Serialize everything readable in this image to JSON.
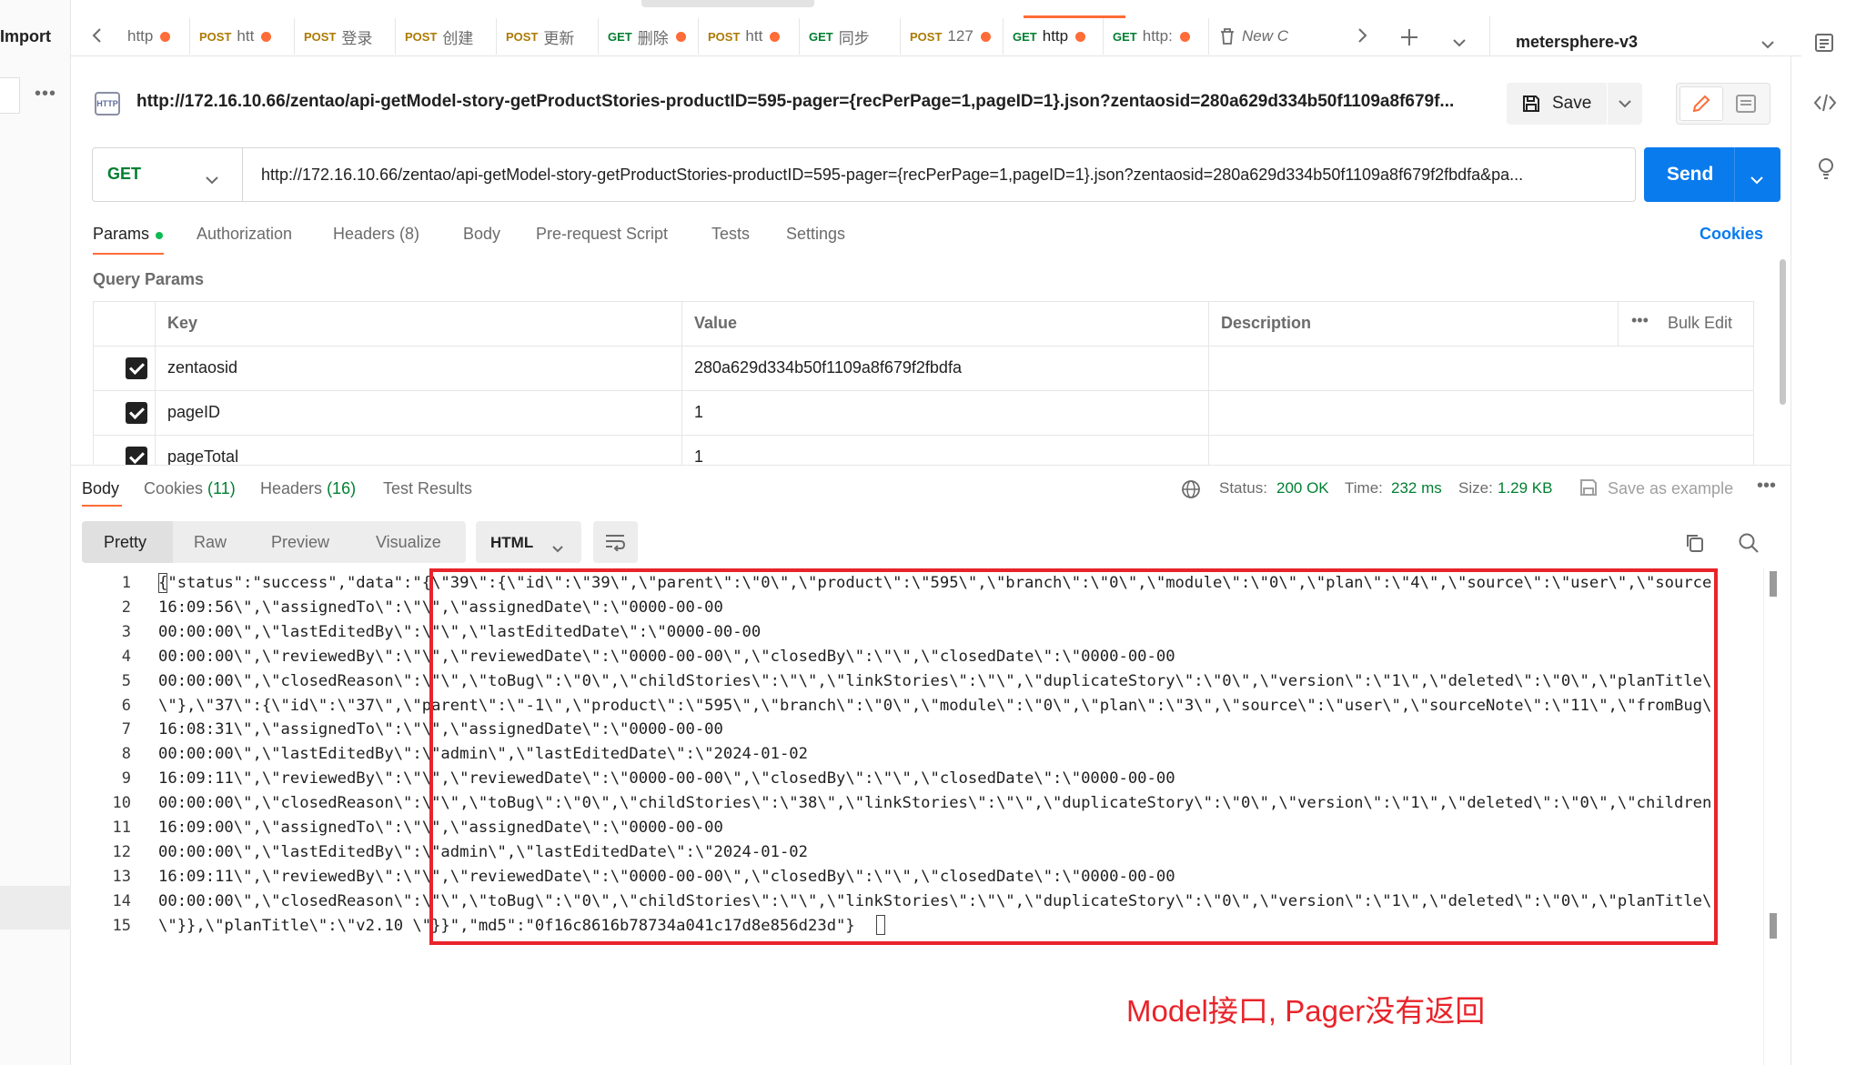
{
  "sidebar": {
    "import_label": "Import",
    "more_glyph": "•••"
  },
  "tabs": [
    {
      "method": "",
      "title": "http",
      "dot": true
    },
    {
      "method": "POST",
      "title": "htt",
      "dot": true
    },
    {
      "method": "POST",
      "title": "登录",
      "dot": false
    },
    {
      "method": "POST",
      "title": "创建",
      "dot": false
    },
    {
      "method": "POST",
      "title": "更新",
      "dot": false
    },
    {
      "method": "GET",
      "title": "删除",
      "dot": true
    },
    {
      "method": "POST",
      "title": "htt",
      "dot": true
    },
    {
      "method": "GET",
      "title": "同步",
      "dot": false
    },
    {
      "method": "POST",
      "title": "127",
      "dot": true
    },
    {
      "method": "GET",
      "title": "http",
      "dot": true
    },
    {
      "method": "GET",
      "title": "http:",
      "dot": true
    },
    {
      "method": "",
      "title": "New C",
      "dot": false
    }
  ],
  "workspace": {
    "name": "metersphere-v3"
  },
  "request": {
    "title": "http://172.16.10.66/zentao/api-getModel-story-getProductStories-productID=595-pager={recPerPage=1,pageID=1}.json?zentaosid=280a629d334b50f1109a8f679f...",
    "method": "GET",
    "url": "http://172.16.10.66/zentao/api-getModel-story-getProductStories-productID=595-pager={recPerPage=1,pageID=1}.json?zentaosid=280a629d334b50f1109a8f679f2fbdfa&pa...",
    "save_label": "Save",
    "send_label": "Send"
  },
  "req_tabs": {
    "params": "Params",
    "authorization": "Authorization",
    "headers": "Headers (8)",
    "body": "Body",
    "prerequest": "Pre-request Script",
    "tests": "Tests",
    "settings": "Settings",
    "cookies": "Cookies"
  },
  "query_params": {
    "title": "Query Params",
    "headers": {
      "key": "Key",
      "value": "Value",
      "description": "Description",
      "bulk_edit": "Bulk Edit"
    },
    "rows": [
      {
        "key": "zentaosid",
        "value": "280a629d334b50f1109a8f679f2fbdfa",
        "checked": true
      },
      {
        "key": "pageID",
        "value": "1",
        "checked": true
      },
      {
        "key": "pageTotal",
        "value": "1",
        "checked": true
      }
    ]
  },
  "response": {
    "tabs": {
      "body": "Body",
      "cookies": "Cookies",
      "cookies_count": "(11)",
      "headers": "Headers",
      "headers_count": "(16)",
      "test_results": "Test Results"
    },
    "status_label": "Status:",
    "status_value": "200 OK",
    "time_label": "Time:",
    "time_value": "232 ms",
    "size_label": "Size:",
    "size_value": "1.29 KB",
    "save_example": "Save as example",
    "views": {
      "pretty": "Pretty",
      "raw": "Raw",
      "preview": "Preview",
      "visualize": "Visualize"
    },
    "lang": "HTML",
    "lines": [
      "{\"status\":\"success\",\"data\":\"{\\\"39\\\":{\\\"id\\\":\\\"39\\\",\\\"parent\\\":\\\"0\\\",\\\"product\\\":\\\"595\\\",\\\"branch\\\":\\\"0\\\",\\\"module\\\":\\\"0\\\",\\\"plan\\\":\\\"4\\\",\\\"source\\\":\\\"user\\\",\\\"source",
      "16:09:56\\\",\\\"assignedTo\\\":\\\"\\\",\\\"assignedDate\\\":\\\"0000-00-00",
      "00:00:00\\\",\\\"lastEditedBy\\\":\\\"\\\",\\\"lastEditedDate\\\":\\\"0000-00-00",
      "00:00:00\\\",\\\"reviewedBy\\\":\\\"\\\",\\\"reviewedDate\\\":\\\"0000-00-00\\\",\\\"closedBy\\\":\\\"\\\",\\\"closedDate\\\":\\\"0000-00-00",
      "00:00:00\\\",\\\"closedReason\\\":\\\"\\\",\\\"toBug\\\":\\\"0\\\",\\\"childStories\\\":\\\"\\\",\\\"linkStories\\\":\\\"\\\",\\\"duplicateStory\\\":\\\"0\\\",\\\"version\\\":\\\"1\\\",\\\"deleted\\\":\\\"0\\\",\\\"planTitle\\",
      "\\\"},\\\"37\\\":{\\\"id\\\":\\\"37\\\",\\\"parent\\\":\\\"-1\\\",\\\"product\\\":\\\"595\\\",\\\"branch\\\":\\\"0\\\",\\\"module\\\":\\\"0\\\",\\\"plan\\\":\\\"3\\\",\\\"source\\\":\\\"user\\\",\\\"sourceNote\\\":\\\"11\\\",\\\"fromBug\\",
      "16:08:31\\\",\\\"assignedTo\\\":\\\"\\\",\\\"assignedDate\\\":\\\"0000-00-00",
      "00:00:00\\\",\\\"lastEditedBy\\\":\\\"admin\\\",\\\"lastEditedDate\\\":\\\"2024-01-02",
      "16:09:11\\\",\\\"reviewedBy\\\":\\\"\\\",\\\"reviewedDate\\\":\\\"0000-00-00\\\",\\\"closedBy\\\":\\\"\\\",\\\"closedDate\\\":\\\"0000-00-00",
      "00:00:00\\\",\\\"closedReason\\\":\\\"\\\",\\\"toBug\\\":\\\"0\\\",\\\"childStories\\\":\\\"38\\\",\\\"linkStories\\\":\\\"\\\",\\\"duplicateStory\\\":\\\"0\\\",\\\"version\\\":\\\"1\\\",\\\"deleted\\\":\\\"0\\\",\\\"children",
      "16:09:00\\\",\\\"assignedTo\\\":\\\"\\\",\\\"assignedDate\\\":\\\"0000-00-00",
      "00:00:00\\\",\\\"lastEditedBy\\\":\\\"admin\\\",\\\"lastEditedDate\\\":\\\"2024-01-02",
      "16:09:11\\\",\\\"reviewedBy\\\":\\\"\\\",\\\"reviewedDate\\\":\\\"0000-00-00\\\",\\\"closedBy\\\":\\\"\\\",\\\"closedDate\\\":\\\"0000-00-00",
      "00:00:00\\\",\\\"closedReason\\\":\\\"\\\",\\\"toBug\\\":\\\"0\\\",\\\"childStories\\\":\\\"\\\",\\\"linkStories\\\":\\\"\\\",\\\"duplicateStory\\\":\\\"0\\\",\\\"version\\\":\\\"1\\\",\\\"deleted\\\":\\\"0\\\",\\\"planTitle\\",
      "\\\"}},\\\"planTitle\\\":\\\"v2.10 \\\"}}\",\"md5\":\"0f16c8616b78734a041c17d8e856d23d\"}"
    ]
  },
  "annotation": "Model接口, Pager没有返回",
  "colors": {
    "accent": "#ff6c37",
    "send": "#097bed",
    "get": "#007f31",
    "post": "#ad7a03",
    "highlight": "#e8242a"
  }
}
